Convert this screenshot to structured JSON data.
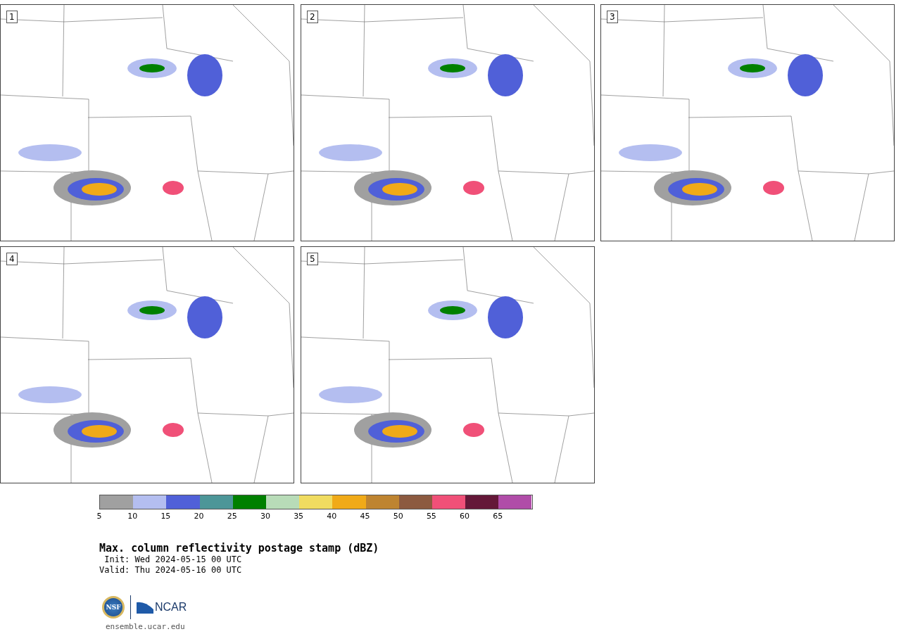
{
  "panels": [
    {
      "label": "1"
    },
    {
      "label": "2"
    },
    {
      "label": "3"
    },
    {
      "label": "4"
    },
    {
      "label": "5"
    }
  ],
  "colorbar": [
    {
      "tick": "5",
      "color": "#a0a0a0"
    },
    {
      "tick": "10",
      "color": "#b4bef0"
    },
    {
      "tick": "15",
      "color": "#5060d8"
    },
    {
      "tick": "20",
      "color": "#4c9698"
    },
    {
      "tick": "25",
      "color": "#008000"
    },
    {
      "tick": "30",
      "color": "#b8dcb8"
    },
    {
      "tick": "35",
      "color": "#f0dc60"
    },
    {
      "tick": "40",
      "color": "#f0aa18"
    },
    {
      "tick": "45",
      "color": "#be8430"
    },
    {
      "tick": "50",
      "color": "#8c5a40"
    },
    {
      "tick": "55",
      "color": "#f05078"
    },
    {
      "tick": "60",
      "color": "#641838"
    },
    {
      "tick": "65",
      "color": "#b04ca8"
    }
  ],
  "title": "Max. column reflectivity postage stamp (dBZ)",
  "init": " Init: Wed 2024-05-15 00 UTC",
  "valid": "Valid: Thu 2024-05-16 00 UTC",
  "logos": {
    "nsf": "NSF",
    "ncar": "NCAR"
  },
  "url": "ensemble.ucar.edu"
}
